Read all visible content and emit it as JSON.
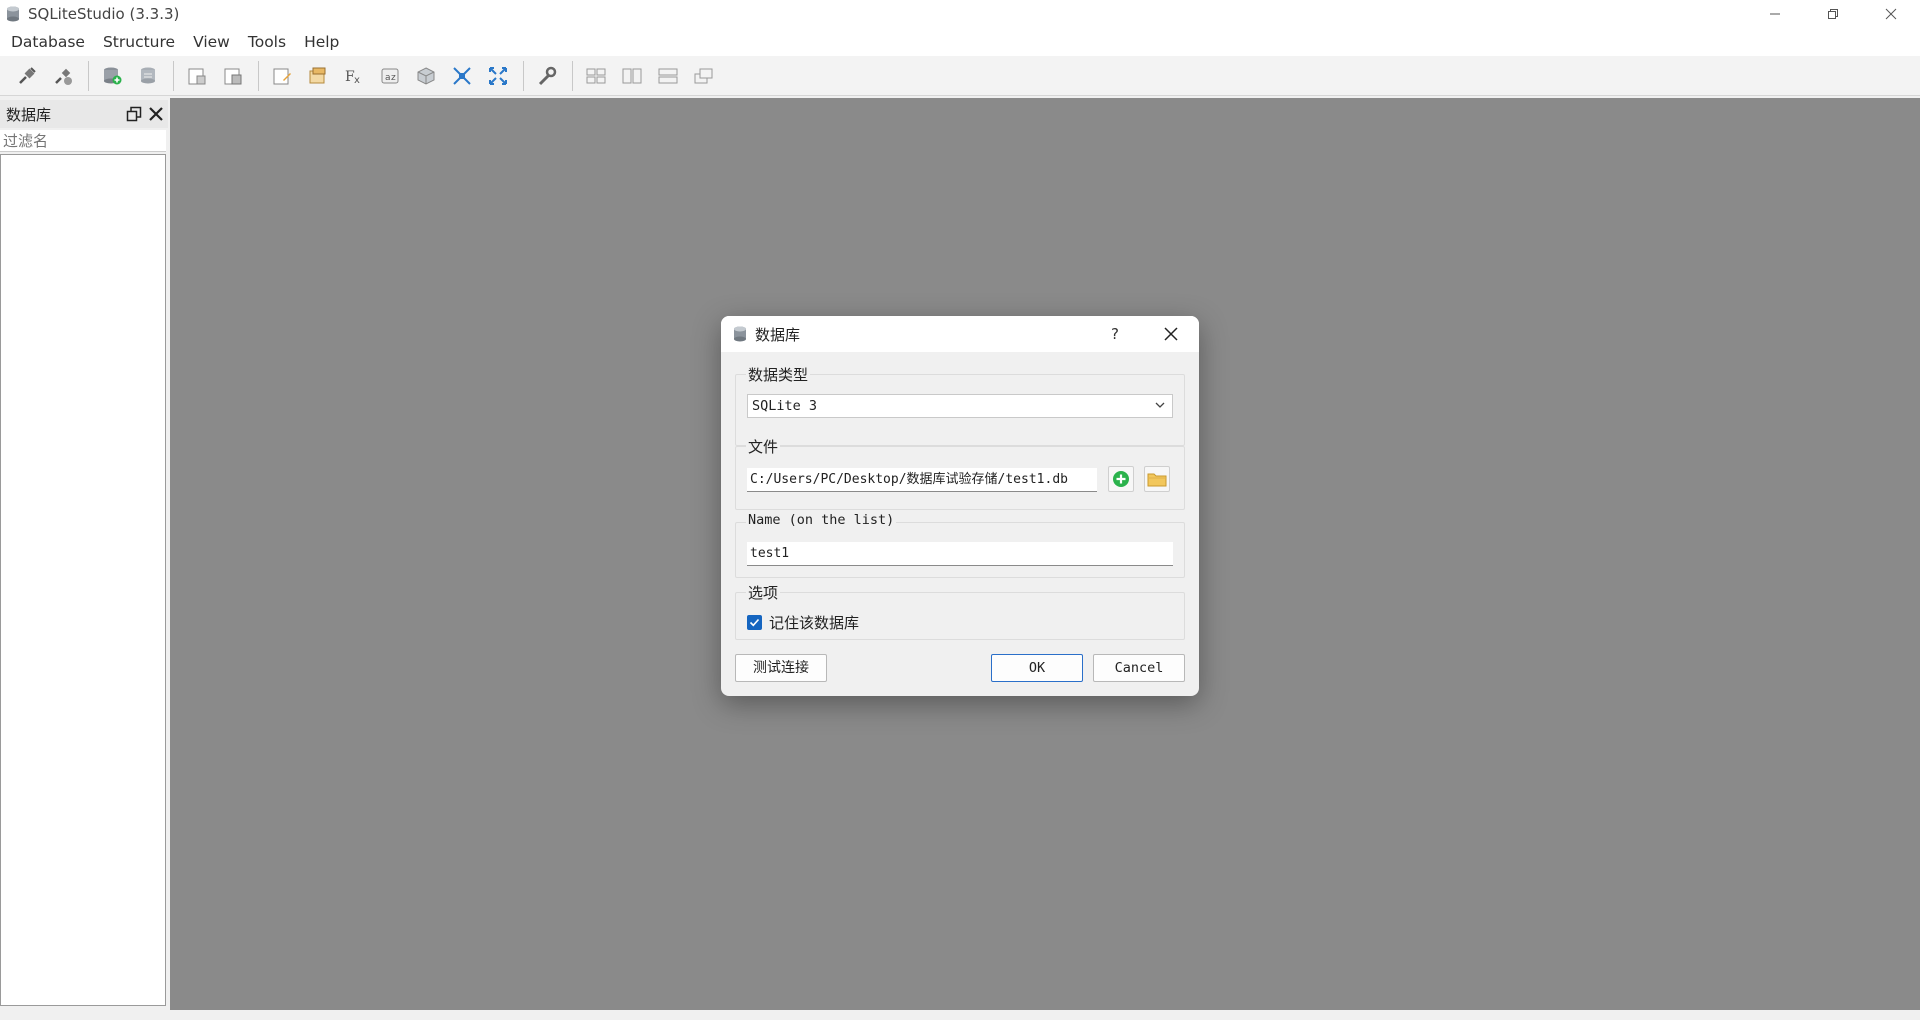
{
  "window": {
    "title": "SQLiteStudio (3.3.3)",
    "controls": [
      "minimize",
      "restore",
      "close"
    ]
  },
  "menu": [
    "Database",
    "Structure",
    "View",
    "Tools",
    "Help"
  ],
  "toolbar": {
    "groups": [
      [
        "connect-icon",
        "disconnect-icon"
      ],
      [
        "add-database-icon",
        "edit-database-icon"
      ],
      [
        "open-sql-editor-icon",
        "open-ddl-history-icon"
      ],
      [
        "create-table-icon",
        "create-index-icon",
        "sql-functions-icon",
        "collations-icon",
        "extensions-icon",
        "tile-icon",
        "tile-horizontal-icon"
      ],
      [
        "configure-icon"
      ],
      [
        "cascade-icon",
        "tile-vertical-icon",
        "tile-horizontal-2-icon",
        "restore-windows-icon"
      ]
    ]
  },
  "dock": {
    "title": "数据库",
    "filter_placeholder": "过滤名"
  },
  "dialog": {
    "title": "数据库",
    "help": "?",
    "type_group_label": "数据类型",
    "type_value": "SQLite 3",
    "file_group_label": "文件",
    "file_path": "C:/Users/PC/Desktop/数据库试验存储/test1.db",
    "name_group_label": "Name (on the list)",
    "name_value": "test1",
    "options_group_label": "选项",
    "remember_label": "记住该数据库",
    "remember_checked": true,
    "test_button": "测试连接",
    "ok_button": "OK",
    "cancel_button": "Cancel"
  },
  "colors": {
    "workspace": "#8a8a8a",
    "accent": "#1565c0",
    "add_green": "#2bb24c"
  }
}
